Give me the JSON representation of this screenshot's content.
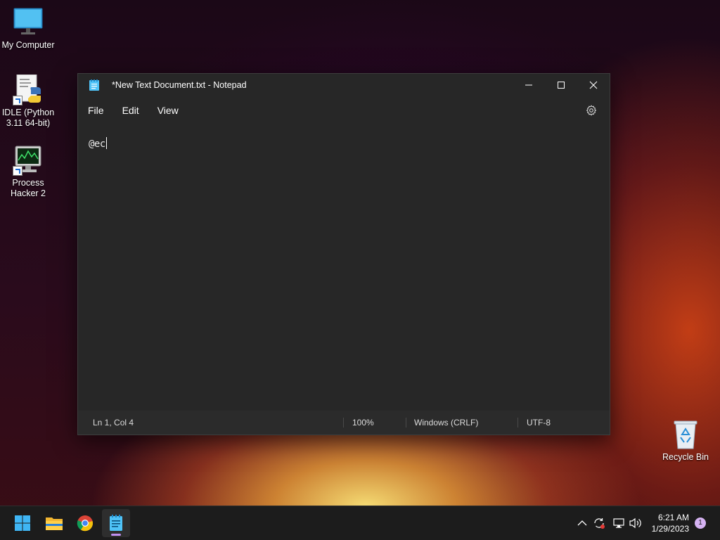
{
  "desktop": {
    "icons": [
      {
        "label": "My Computer"
      },
      {
        "label": "IDLE (Python 3.11 64-bit)"
      },
      {
        "label": "Process Hacker 2"
      },
      {
        "label": "Recycle Bin"
      }
    ]
  },
  "window": {
    "title": "*New Text Document.txt - Notepad",
    "menu": [
      "File",
      "Edit",
      "View"
    ],
    "content": "@ec",
    "status": {
      "position": "Ln 1, Col 4",
      "zoom": "100%",
      "line_ending": "Windows (CRLF)",
      "encoding": "UTF-8"
    }
  },
  "taskbar": {
    "apps": [
      "start-icon",
      "file-explorer-icon",
      "chrome-icon",
      "notepad-icon"
    ],
    "clock": {
      "time": "6:21 AM",
      "date": "1/29/2023"
    },
    "notifications": "1"
  },
  "colors": {
    "accent": "#c08ff0",
    "window_bg": "#272727",
    "taskbar_bg": "#1c1c1c"
  }
}
